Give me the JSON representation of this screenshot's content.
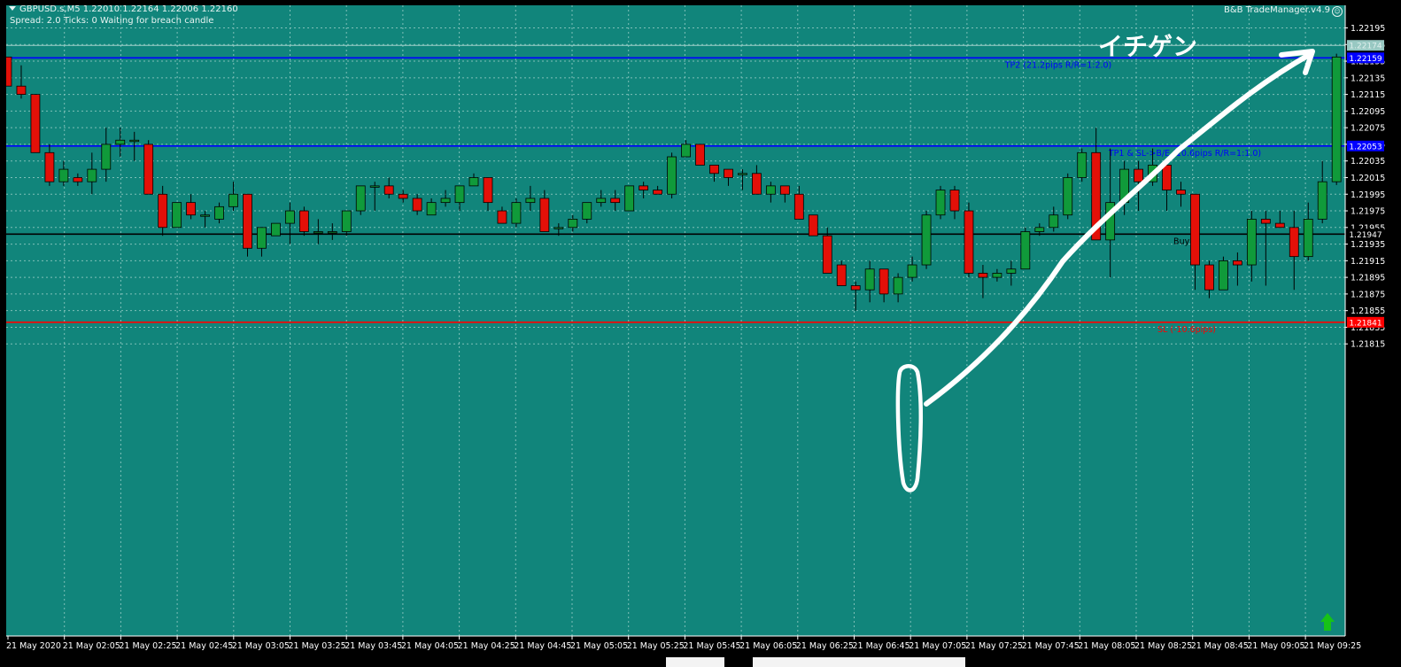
{
  "header": {
    "symbol_line": "GBPUSD.s,M5  1.22010 1.22164 1.22006 1.22160",
    "status_line": "Spread: 2.0  Ticks: 0  Waiting for breach candle",
    "ea_name": "B&B TradeManager.v4.9"
  },
  "annotation_text": "イチゲン",
  "colors": {
    "background": "#11857b",
    "grid": "#7fc0b8",
    "bull": "#109a3a",
    "bear": "#e31008",
    "wick": "#000000",
    "tp_line": "#0000ff",
    "entry_line": "#000000",
    "sl_line": "#ff0000",
    "ask_line": "#9fd0ca",
    "hand_drawn": "#ffffff",
    "axis_text": "#ffffff",
    "up_arrow": "#17c217"
  },
  "chart_data": {
    "type": "candlestick",
    "symbol": "GBPUSD.s",
    "timeframe": "M5",
    "ylim": [
      1.2181,
      1.2221
    ],
    "y_ticks": [
      "1.22195",
      "1.22175",
      "1.22155",
      "1.22135",
      "1.22115",
      "1.22095",
      "1.22075",
      "1.22055",
      "1.22035",
      "1.22015",
      "1.21995",
      "1.21975",
      "1.21955",
      "1.21935",
      "1.21915",
      "1.21895",
      "1.21875",
      "1.21855",
      "1.21835",
      "1.21815"
    ],
    "x_ticks": [
      "21 May 2020",
      "21 May 02:05",
      "21 May 02:25",
      "21 May 02:45",
      "21 May 03:05",
      "21 May 03:25",
      "21 May 03:45",
      "21 May 04:05",
      "21 May 04:25",
      "21 May 04:45",
      "21 May 05:05",
      "21 May 05:25",
      "21 May 05:45",
      "21 May 06:05",
      "21 May 06:25",
      "21 May 06:45",
      "21 May 07:05",
      "21 May 07:25",
      "21 May 07:45",
      "21 May 08:05",
      "21 May 08:25",
      "21 May 08:45",
      "21 May 09:05",
      "21 May 09:25"
    ],
    "levels": [
      {
        "name": "TP2",
        "price": 1.22159,
        "label": "TP2 (21.2pips R/R=1:2.0)",
        "tag": "1.22159",
        "color": "#0000ff"
      },
      {
        "name": "TP1",
        "price": 1.22053,
        "label": "TP1 & SL->B/E (10.6pips R/R=1:1.0)",
        "tag": "1.22053",
        "color": "#0000ff"
      },
      {
        "name": "BuyEP",
        "price": 1.21947,
        "label": "BuyEP",
        "tag": "1.21947",
        "color": "#000000"
      },
      {
        "name": "SL",
        "price": 1.21841,
        "label": "SL (-10.6pips)",
        "tag": "1.21841",
        "color": "#ff0000"
      },
      {
        "name": "Ask",
        "price": 1.22174,
        "label": "",
        "tag": "1.22174",
        "color": "#9fd0ca"
      }
    ],
    "candles": [
      [
        1.2216,
        1.2216,
        1.22125,
        1.22125
      ],
      [
        1.22125,
        1.2215,
        1.2211,
        1.22115
      ],
      [
        1.22115,
        1.22115,
        1.22045,
        1.22045
      ],
      [
        1.22045,
        1.22055,
        1.22005,
        1.2201
      ],
      [
        1.2201,
        1.22035,
        1.22005,
        1.22025
      ],
      [
        1.22015,
        1.2202,
        1.22005,
        1.2201
      ],
      [
        1.2201,
        1.22045,
        1.21995,
        1.22025
      ],
      [
        1.22025,
        1.22075,
        1.2201,
        1.22055
      ],
      [
        1.22055,
        1.22075,
        1.2204,
        1.2206
      ],
      [
        1.2206,
        1.2207,
        1.22035,
        1.2206
      ],
      [
        1.22055,
        1.2206,
        1.21995,
        1.21995
      ],
      [
        1.21995,
        1.22005,
        1.21945,
        1.21955
      ],
      [
        1.21955,
        1.21985,
        1.21955,
        1.21985
      ],
      [
        1.21985,
        1.21995,
        1.21965,
        1.2197
      ],
      [
        1.2197,
        1.21975,
        1.21955,
        1.2197
      ],
      [
        1.21965,
        1.21985,
        1.2196,
        1.2198
      ],
      [
        1.2198,
        1.2201,
        1.21975,
        1.21995
      ],
      [
        1.21995,
        1.21995,
        1.2192,
        1.2193
      ],
      [
        1.2193,
        1.21955,
        1.2192,
        1.21955
      ],
      [
        1.21945,
        1.2196,
        1.21945,
        1.2196
      ],
      [
        1.2196,
        1.21985,
        1.21935,
        1.21975
      ],
      [
        1.21975,
        1.2198,
        1.21945,
        1.2195
      ],
      [
        1.2195,
        1.21965,
        1.21935,
        1.2195
      ],
      [
        1.2195,
        1.2196,
        1.2194,
        1.2195
      ],
      [
        1.2195,
        1.2197,
        1.21945,
        1.21975
      ],
      [
        1.21975,
        1.22,
        1.2197,
        1.22005
      ],
      [
        1.22005,
        1.2201,
        1.21975,
        1.22005
      ],
      [
        1.22005,
        1.22015,
        1.2199,
        1.21995
      ],
      [
        1.21995,
        1.22,
        1.21985,
        1.2199
      ],
      [
        1.2199,
        1.21995,
        1.2197,
        1.21975
      ],
      [
        1.2197,
        1.2199,
        1.2197,
        1.21985
      ],
      [
        1.21985,
        1.22,
        1.2198,
        1.2199
      ],
      [
        1.21985,
        1.22005,
        1.21975,
        1.22005
      ],
      [
        1.22005,
        1.2202,
        1.22005,
        1.22015
      ],
      [
        1.22015,
        1.22015,
        1.21975,
        1.21985
      ],
      [
        1.21975,
        1.2198,
        1.21965,
        1.2196
      ],
      [
        1.2196,
        1.2199,
        1.21955,
        1.21985
      ],
      [
        1.21985,
        1.22005,
        1.21975,
        1.2199
      ],
      [
        1.2199,
        1.22,
        1.21955,
        1.2195
      ],
      [
        1.21955,
        1.2196,
        1.21945,
        1.21955
      ],
      [
        1.21955,
        1.2197,
        1.2195,
        1.21965
      ],
      [
        1.21965,
        1.21985,
        1.2196,
        1.21985
      ],
      [
        1.21985,
        1.22,
        1.2198,
        1.2199
      ],
      [
        1.2199,
        1.22,
        1.21975,
        1.21985
      ],
      [
        1.21975,
        1.22005,
        1.21975,
        1.22005
      ],
      [
        1.22005,
        1.2201,
        1.2199,
        1.22
      ],
      [
        1.22,
        1.22005,
        1.21995,
        1.21995
      ],
      [
        1.21995,
        1.22045,
        1.2199,
        1.2204
      ],
      [
        1.2204,
        1.2206,
        1.2204,
        1.22055
      ],
      [
        1.22055,
        1.22055,
        1.2203,
        1.2203
      ],
      [
        1.2203,
        1.2203,
        1.2201,
        1.2202
      ],
      [
        1.22025,
        1.22025,
        1.22005,
        1.22015
      ],
      [
        1.2202,
        1.22025,
        1.22,
        1.2202
      ],
      [
        1.2202,
        1.2203,
        1.21995,
        1.21995
      ],
      [
        1.21995,
        1.2201,
        1.21985,
        1.22005
      ],
      [
        1.22005,
        1.22005,
        1.21985,
        1.21995
      ],
      [
        1.21995,
        1.22005,
        1.21965,
        1.21965
      ],
      [
        1.2197,
        1.2197,
        1.2195,
        1.21945
      ],
      [
        1.21945,
        1.21955,
        1.219,
        1.219
      ],
      [
        1.2191,
        1.21915,
        1.2189,
        1.21885
      ],
      [
        1.21885,
        1.2189,
        1.21855,
        1.2188
      ],
      [
        1.2188,
        1.21915,
        1.21865,
        1.21905
      ],
      [
        1.21905,
        1.21905,
        1.21865,
        1.21875
      ],
      [
        1.21875,
        1.219,
        1.21865,
        1.21895
      ],
      [
        1.21895,
        1.2192,
        1.2189,
        1.2191
      ],
      [
        1.2191,
        1.21975,
        1.21905,
        1.2197
      ],
      [
        1.2197,
        1.22005,
        1.21965,
        1.22
      ],
      [
        1.22,
        1.22005,
        1.21965,
        1.21975
      ],
      [
        1.21975,
        1.21985,
        1.21895,
        1.219
      ],
      [
        1.219,
        1.2191,
        1.2187,
        1.21895
      ],
      [
        1.21895,
        1.21905,
        1.2189,
        1.219
      ],
      [
        1.219,
        1.21915,
        1.21885,
        1.21905
      ],
      [
        1.21905,
        1.21955,
        1.21905,
        1.2195
      ],
      [
        1.2195,
        1.2196,
        1.21945,
        1.21955
      ],
      [
        1.21955,
        1.2198,
        1.2195,
        1.2197
      ],
      [
        1.2197,
        1.2202,
        1.21965,
        1.22015
      ],
      [
        1.22015,
        1.2205,
        1.2201,
        1.22045
      ],
      [
        1.22045,
        1.22075,
        1.2194,
        1.2194
      ],
      [
        1.2194,
        1.2205,
        1.21895,
        1.21985
      ],
      [
        1.21985,
        1.22035,
        1.2197,
        1.22025
      ],
      [
        1.22025,
        1.22035,
        1.21975,
        1.2201
      ],
      [
        1.2201,
        1.2205,
        1.22005,
        1.2203
      ],
      [
        1.2203,
        1.22035,
        1.21975,
        1.22
      ],
      [
        1.22,
        1.2201,
        1.2198,
        1.21995
      ],
      [
        1.21995,
        1.21995,
        1.2188,
        1.2191
      ],
      [
        1.2191,
        1.21915,
        1.2187,
        1.2188
      ],
      [
        1.2188,
        1.2192,
        1.2188,
        1.21915
      ],
      [
        1.21915,
        1.21925,
        1.21885,
        1.2191
      ],
      [
        1.2191,
        1.21975,
        1.2189,
        1.21965
      ],
      [
        1.21965,
        1.21975,
        1.21885,
        1.2196
      ],
      [
        1.2196,
        1.21975,
        1.21955,
        1.21955
      ],
      [
        1.21955,
        1.21975,
        1.2188,
        1.2192
      ],
      [
        1.2192,
        1.21985,
        1.21915,
        1.21965
      ],
      [
        1.21965,
        1.22035,
        1.2196,
        1.2201
      ],
      [
        1.2201,
        1.22164,
        1.22006,
        1.2216
      ]
    ]
  }
}
